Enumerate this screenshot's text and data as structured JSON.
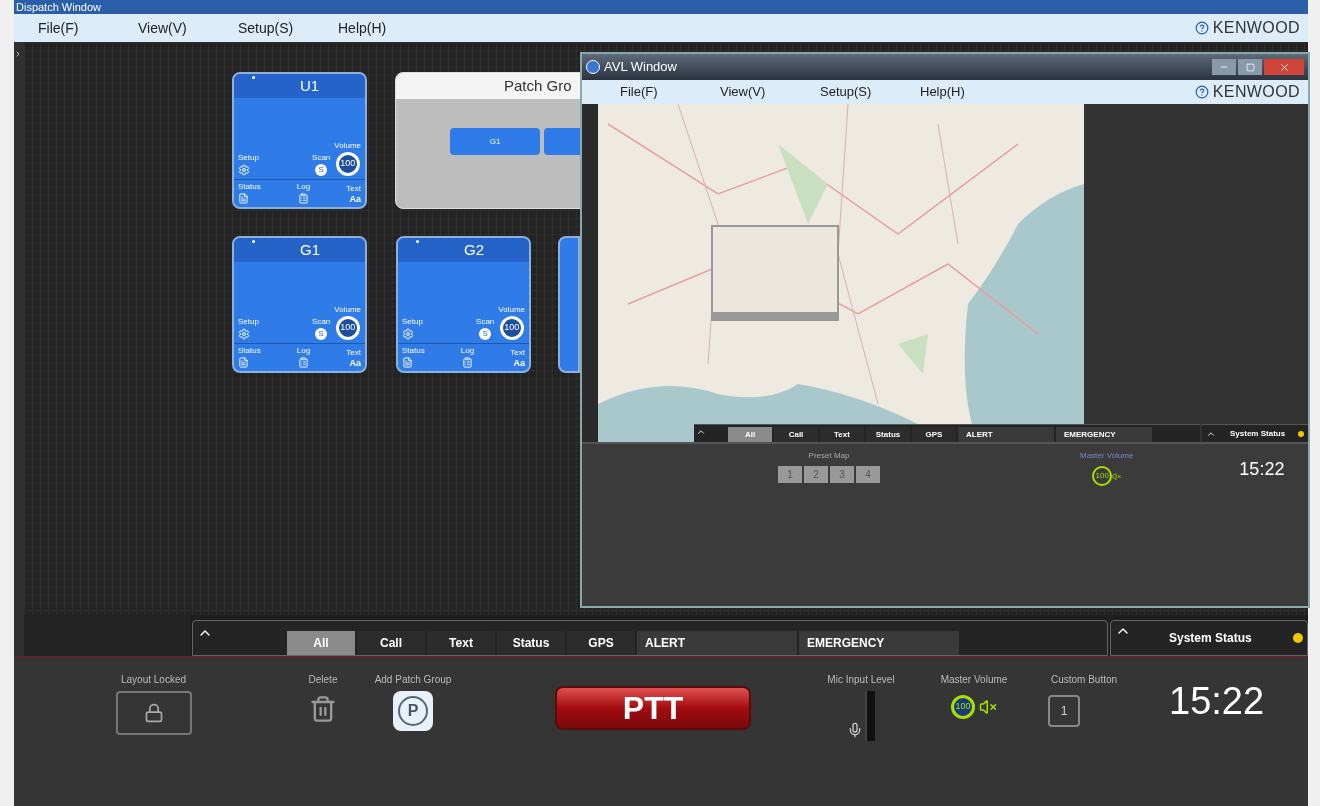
{
  "dispatch_window": {
    "title": "Dispatch Window",
    "menu": [
      "File(F)",
      "View(V)",
      "Setup(S)",
      "Help(H)"
    ],
    "brand": "KENWOOD"
  },
  "cards": [
    {
      "title": "U1",
      "setup": "Setup",
      "scan": "Scan",
      "scan_icon": "S",
      "volume_label": "Volume",
      "volume": "100",
      "status": "Status",
      "log": "Log",
      "text": "Text",
      "text_icon": "Aa"
    },
    {
      "title": "G1",
      "setup": "Setup",
      "scan": "Scan",
      "scan_icon": "S",
      "volume_label": "Volume",
      "volume": "100",
      "status": "Status",
      "log": "Log",
      "text": "Text",
      "text_icon": "Aa"
    },
    {
      "title": "G2",
      "setup": "Setup",
      "scan": "Scan",
      "scan_icon": "S",
      "volume_label": "Volume",
      "volume": "100",
      "status": "Status",
      "log": "Log",
      "text": "Text",
      "text_icon": "Aa"
    }
  ],
  "patch_group": {
    "title": "Patch Gro",
    "members": [
      "G1"
    ]
  },
  "avl_window": {
    "title": "AVL Window",
    "menu": [
      "File(F)",
      "View(V)",
      "Setup(S)",
      "Help(H)"
    ],
    "brand": "KENWOOD",
    "tabs": [
      {
        "label": "All",
        "kind": "filter",
        "selected": true
      },
      {
        "label": "Call",
        "kind": "filter",
        "selected": false
      },
      {
        "label": "Text",
        "kind": "filter",
        "selected": false
      },
      {
        "label": "Status",
        "kind": "filter",
        "selected": false
      },
      {
        "label": "GPS",
        "kind": "filter",
        "selected": false
      },
      {
        "label": "ALERT",
        "kind": "alert",
        "selected": false
      },
      {
        "label": "EMERGENCY",
        "kind": "alert",
        "selected": false
      }
    ],
    "system_status": "System Status",
    "preset_label": "Preset Map",
    "presets": [
      "1",
      "2",
      "3",
      "4"
    ],
    "master_volume_label": "Master Volume",
    "volume": "100",
    "time": "15:22"
  },
  "message_bar": {
    "tabs": [
      {
        "label": "All",
        "kind": "filter",
        "selected": true
      },
      {
        "label": "Call",
        "kind": "filter",
        "selected": false
      },
      {
        "label": "Text",
        "kind": "filter",
        "selected": false
      },
      {
        "label": "Status",
        "kind": "filter",
        "selected": false
      },
      {
        "label": "GPS",
        "kind": "filter",
        "selected": false
      },
      {
        "label": "ALERT",
        "kind": "alert",
        "selected": false
      },
      {
        "label": "EMERGENCY",
        "kind": "alert",
        "selected": false
      }
    ],
    "system_status": "System Status"
  },
  "toolbar": {
    "layout_locked": "Layout Locked",
    "delete": "Delete",
    "add_patch_group": "Add Patch Group",
    "patch_icon": "P",
    "ptt": "PTT",
    "mic_input_level": "Mic Input Level",
    "master_volume": "Master Volume",
    "volume": "100",
    "custom_button": "Custom Button",
    "custom_key": "1",
    "time": "15:22"
  }
}
